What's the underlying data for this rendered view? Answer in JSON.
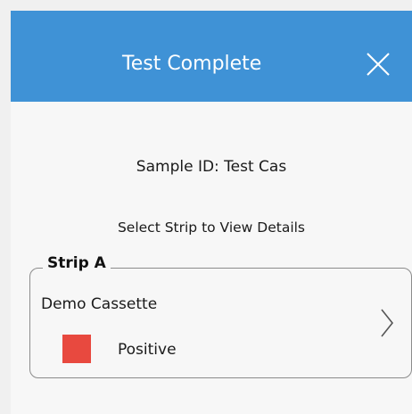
{
  "header": {
    "title": "Test Complete",
    "background": "#3f92d6",
    "close_icon": "close-icon"
  },
  "sample": {
    "label": "Sample ID: Test Cas"
  },
  "instructions": {
    "text": "Select Strip to View Details"
  },
  "strip": {
    "legend": "Strip A",
    "cassette_name": "Demo Cassette",
    "status": "Positive",
    "status_color": "#e8493f",
    "chevron_icon": "chevron-right-icon"
  }
}
